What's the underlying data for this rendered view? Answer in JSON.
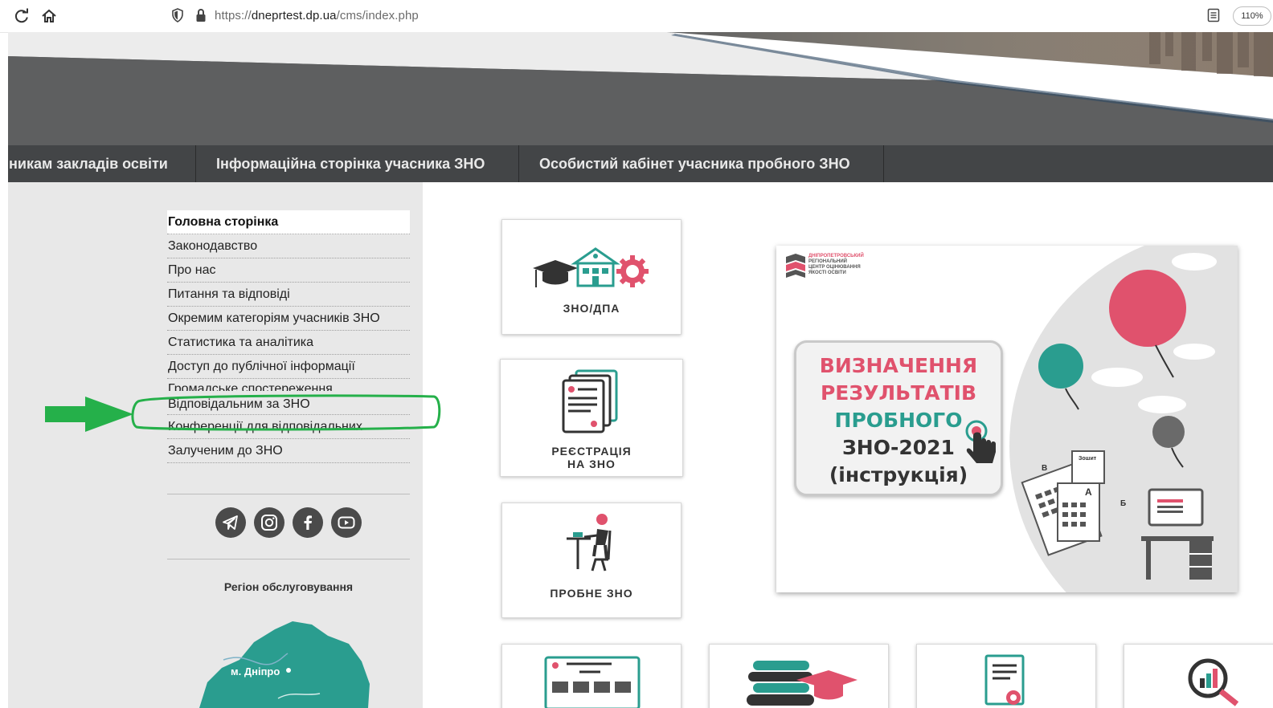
{
  "browser": {
    "url_prefix": "https://",
    "url_host": "dneprtest.dp.ua",
    "url_path": "/cms/index.php",
    "zoom": "110%"
  },
  "topnav": {
    "items": [
      {
        "label": "никам закладів освіти"
      },
      {
        "label": "Інформаційна сторінка учасника ЗНО"
      },
      {
        "label": "Особистий кабінет учасника пробного ЗНО"
      }
    ]
  },
  "sidebar": {
    "menu": [
      {
        "label": "Головна сторінка"
      },
      {
        "label": "Законодавство"
      },
      {
        "label": "Про нас"
      },
      {
        "label": "Питання та відповіді"
      },
      {
        "label": "Окремим категоріям учасників ЗНО"
      },
      {
        "label": "Статистика та аналітика"
      },
      {
        "label": "Доступ до публічної інформації"
      },
      {
        "label": "Громадське спостереження"
      },
      {
        "label": "Відповідальним за ЗНО"
      },
      {
        "label": "Конференції для відповідальних"
      },
      {
        "label": "Залученим до ЗНО"
      }
    ],
    "social_icons": [
      "telegram-icon",
      "instagram-icon",
      "facebook-icon",
      "youtube-icon"
    ],
    "region_title": "Регіон обслуговування",
    "map_label": "м. Дніпро"
  },
  "tiles": [
    {
      "label": "ЗНО/ДПА"
    },
    {
      "label1": "РЕЄСТРАЦІЯ",
      "label2": "НА ЗНО"
    },
    {
      "label": "ПРОБНЕ ЗНО"
    }
  ],
  "promo": {
    "logo_line1": "ДНІПРОПЕТРОВСЬКИЙ",
    "logo_line2": "РЕГІОНАЛЬНИЙ",
    "logo_line3": "ЦЕНТР ОЦІНЮВАННЯ",
    "logo_line4": "ЯКОСТІ ОСВІТИ",
    "line1": "ВИЗНАЧЕННЯ",
    "line2": "РЕЗУЛЬТАТІВ",
    "line3": "ПРОБНОГО",
    "line4": "ЗНО-2021",
    "line5": "(інструкція)",
    "booklet_label": "Зошит",
    "sheet_letters": [
      "В",
      "А",
      "Б"
    ]
  },
  "colors": {
    "accent_teal": "#2a9d8f",
    "accent_red": "#e0526d",
    "annotation_green": "#25b04a",
    "nav_bg": "#434547"
  }
}
